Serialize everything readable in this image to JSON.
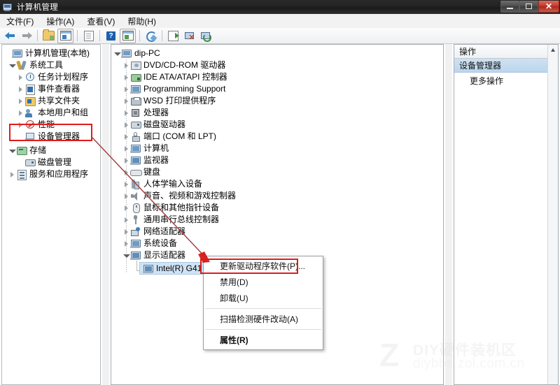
{
  "window": {
    "title": "计算机管理",
    "icon": "computer-management-icon",
    "controls": {
      "minimize": "–",
      "maximize": "❐",
      "close": "✕"
    }
  },
  "menubar": {
    "items": [
      {
        "label": "文件(F)",
        "name": "menu-file"
      },
      {
        "label": "操作(A)",
        "name": "menu-action"
      },
      {
        "label": "查看(V)",
        "name": "menu-view"
      },
      {
        "label": "帮助(H)",
        "name": "menu-help"
      }
    ]
  },
  "toolbar": {
    "buttons": [
      {
        "icon": "back-arrow-icon",
        "name": "toolbar-back"
      },
      {
        "icon": "forward-arrow-icon",
        "name": "toolbar-forward"
      },
      {
        "icon": "folder-up-icon",
        "name": "toolbar-up-folder"
      },
      {
        "icon": "show-tree-icon",
        "name": "toolbar-show-tree"
      },
      {
        "icon": "properties-doc-icon",
        "name": "toolbar-properties"
      },
      {
        "icon": "help-question-icon",
        "name": "toolbar-help"
      },
      {
        "icon": "show-action-pane-icon",
        "name": "toolbar-action-pane"
      },
      {
        "icon": "refresh-icon",
        "name": "toolbar-refresh"
      },
      {
        "icon": "export-list-icon",
        "name": "toolbar-export"
      },
      {
        "icon": "uninstall-device-icon",
        "name": "toolbar-uninstall"
      },
      {
        "icon": "scan-hardware-icon",
        "name": "toolbar-scan"
      }
    ]
  },
  "left_tree": {
    "root": {
      "label": "计算机管理(本地)",
      "icon": "computer-icon"
    },
    "items": [
      {
        "label": "系统工具",
        "icon": "system-tools-icon",
        "indent": 1,
        "state": "open"
      },
      {
        "label": "任务计划程序",
        "icon": "task-scheduler-icon",
        "indent": 2,
        "state": "collapsed"
      },
      {
        "label": "事件查看器",
        "icon": "event-viewer-icon",
        "indent": 2,
        "state": "collapsed"
      },
      {
        "label": "共享文件夹",
        "icon": "shared-folders-icon",
        "indent": 2,
        "state": "collapsed"
      },
      {
        "label": "本地用户和组",
        "icon": "local-users-groups-icon",
        "indent": 2,
        "state": "collapsed"
      },
      {
        "label": "性能",
        "icon": "performance-icon",
        "indent": 2,
        "state": "collapsed"
      },
      {
        "label": "设备管理器",
        "icon": "device-manager-icon",
        "indent": 2,
        "state": "leaf",
        "highlighted": true
      },
      {
        "label": "存储",
        "icon": "storage-icon",
        "indent": 1,
        "state": "open"
      },
      {
        "label": "磁盘管理",
        "icon": "disk-management-icon",
        "indent": 2,
        "state": "leaf"
      },
      {
        "label": "服务和应用程序",
        "icon": "services-apps-icon",
        "indent": 1,
        "state": "collapsed"
      }
    ]
  },
  "device_tree": {
    "root": {
      "label": "dip-PC",
      "icon": "computer-node-icon"
    },
    "items": [
      {
        "label": "DVD/CD-ROM 驱动器",
        "icon": "dvd-drive-icon",
        "state": "collapsed"
      },
      {
        "label": "IDE ATA/ATAPI 控制器",
        "icon": "ide-controller-icon",
        "state": "collapsed"
      },
      {
        "label": "Programming Support",
        "icon": "programming-support-icon",
        "state": "collapsed"
      },
      {
        "label": "WSD 打印提供程序",
        "icon": "printer-icon",
        "state": "collapsed"
      },
      {
        "label": "处理器",
        "icon": "processor-icon",
        "state": "collapsed"
      },
      {
        "label": "磁盘驱动器",
        "icon": "disk-drive-icon",
        "state": "collapsed"
      },
      {
        "label": "端口 (COM 和 LPT)",
        "icon": "port-icon",
        "state": "collapsed"
      },
      {
        "label": "计算机",
        "icon": "computer-node-icon",
        "state": "collapsed"
      },
      {
        "label": "监视器",
        "icon": "monitor-icon",
        "state": "collapsed"
      },
      {
        "label": "键盘",
        "icon": "keyboard-icon",
        "state": "collapsed"
      },
      {
        "label": "人体学输入设备",
        "icon": "hid-icon",
        "state": "collapsed"
      },
      {
        "label": "声音、视频和游戏控制器",
        "icon": "sound-icon",
        "state": "collapsed"
      },
      {
        "label": "鼠标和其他指针设备",
        "icon": "mouse-icon",
        "state": "collapsed"
      },
      {
        "label": "通用串行总线控制器",
        "icon": "usb-icon",
        "state": "collapsed"
      },
      {
        "label": "网络适配器",
        "icon": "network-adapter-icon",
        "state": "collapsed"
      },
      {
        "label": "系统设备",
        "icon": "system-device-icon",
        "state": "collapsed"
      },
      {
        "label": "显示适配器",
        "icon": "display-adapter-icon",
        "state": "open"
      }
    ],
    "selected_child": {
      "label": "Intel(R) G41 E",
      "icon": "display-adapter-icon",
      "selected": true
    }
  },
  "actions_pane": {
    "header": "操作",
    "section": "设备管理器",
    "rows": [
      {
        "label": "更多操作",
        "submenu": true
      }
    ]
  },
  "context_menu": {
    "items": [
      {
        "label": "更新驱动程序软件(P)...",
        "name": "ctx-update-driver",
        "highlighted": true
      },
      {
        "label": "禁用(D)",
        "name": "ctx-disable"
      },
      {
        "label": "卸载(U)",
        "name": "ctx-uninstall"
      },
      {
        "separator": true
      },
      {
        "label": "扫描检测硬件改动(A)",
        "name": "ctx-scan-hardware"
      },
      {
        "separator": true
      },
      {
        "label": "属性(R)",
        "name": "ctx-properties",
        "bold": true
      }
    ]
  },
  "annotations": {
    "highlight_color": "#e01b1b",
    "arrow_color": "#a03a3a"
  },
  "watermark": {
    "logo": "Z",
    "line1": "DIY硬件装机区",
    "line2": "diybbs.zol.com.cn"
  }
}
